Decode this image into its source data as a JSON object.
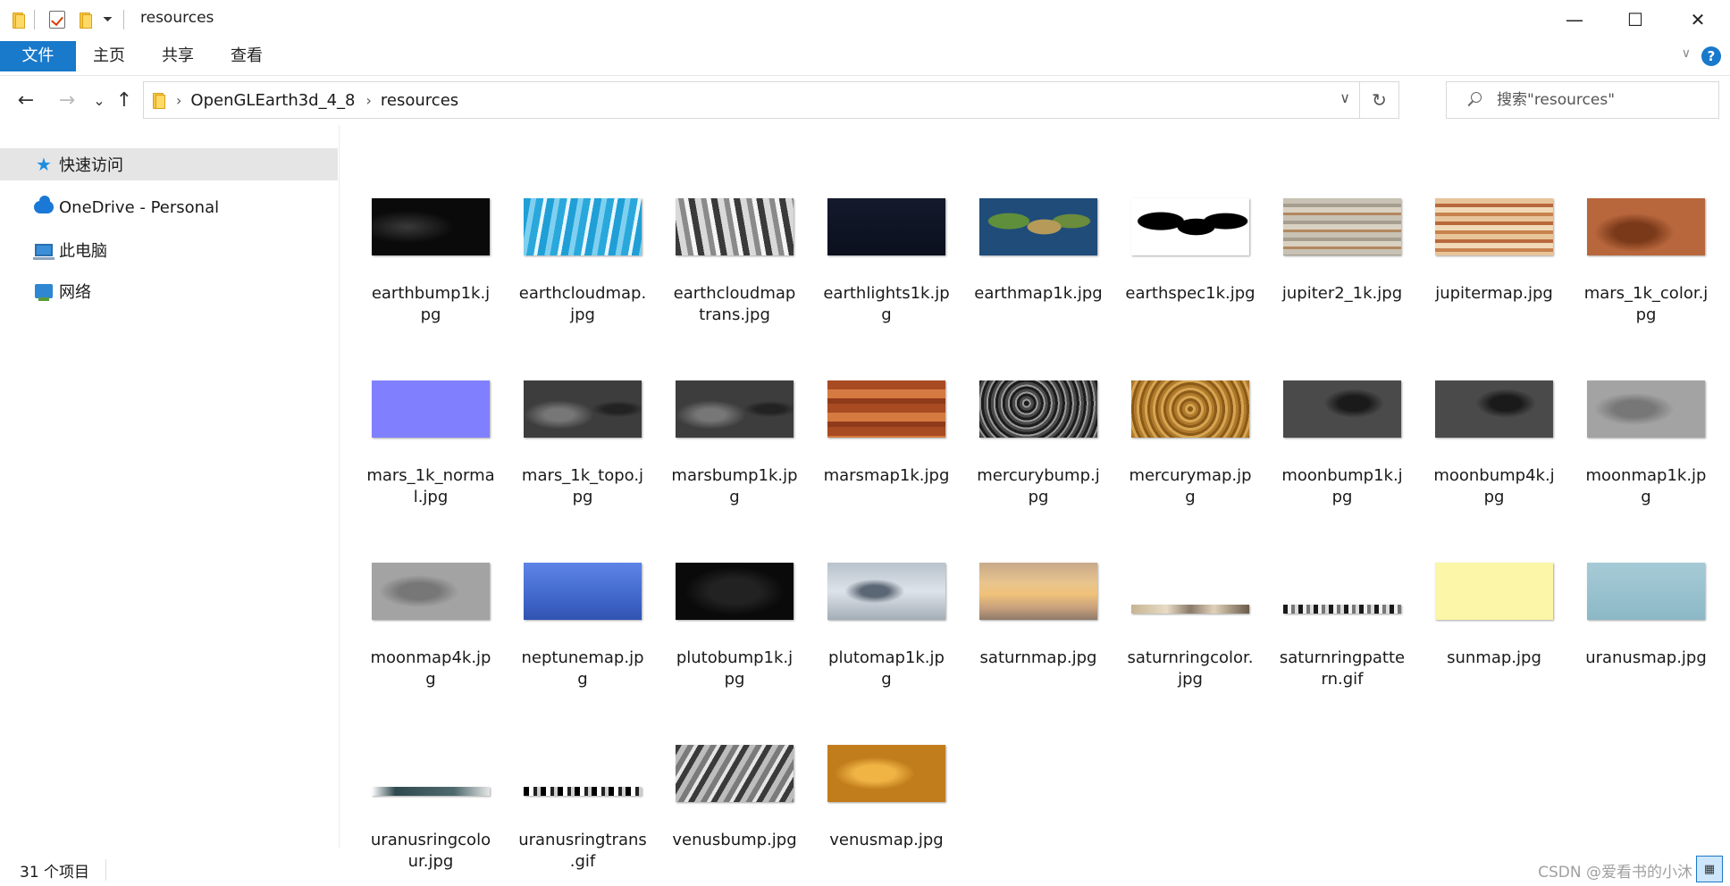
{
  "titlebar": {
    "title": "resources",
    "minimize": "—",
    "maximize": "☐",
    "close": "✕"
  },
  "ribbon": {
    "tabs": [
      "文件",
      "主页",
      "共享",
      "查看"
    ],
    "help": "?"
  },
  "nav": {
    "back": "←",
    "forward": "→",
    "recent": "⌄",
    "up": "↑",
    "breadcrumb": [
      "OpenGLEarth3d_4_8",
      "resources"
    ],
    "search_placeholder": "搜索\"resources\""
  },
  "sidebar": {
    "items": [
      {
        "label": "快速访问",
        "icon": "star-icon"
      },
      {
        "label": "OneDrive - Personal",
        "icon": "cloud-icon"
      },
      {
        "label": "此电脑",
        "icon": "computer-icon"
      },
      {
        "label": "网络",
        "icon": "network-icon"
      }
    ]
  },
  "files": [
    {
      "name": "earthbump1k.jpg",
      "lines": [
        "earthbump1k.j",
        "pg"
      ],
      "thumb": "bump-dark"
    },
    {
      "name": "earthcloudmap.jpg",
      "lines": [
        "earthcloudmap.",
        "jpg"
      ],
      "thumb": "clouds-blue"
    },
    {
      "name": "earthcloudmaptrans.jpg",
      "lines": [
        "earthcloudmap",
        "trans.jpg"
      ],
      "thumb": "clouds-gray"
    },
    {
      "name": "earthlights1k.jpg",
      "lines": [
        "earthlights1k.jp",
        "g"
      ],
      "thumb": "night"
    },
    {
      "name": "earthmap1k.jpg",
      "lines": [
        "earthmap1k.jpg"
      ],
      "thumb": "earth"
    },
    {
      "name": "earthspec1k.jpg",
      "lines": [
        "earthspec1k.jpg"
      ],
      "thumb": "spec"
    },
    {
      "name": "jupiter2_1k.jpg",
      "lines": [
        "jupiter2_1k.jpg"
      ],
      "thumb": "jupiter2"
    },
    {
      "name": "jupitermap.jpg",
      "lines": [
        "jupitermap.jpg"
      ],
      "thumb": "jupiter"
    },
    {
      "name": "mars_1k_color.jpg",
      "lines": [
        "mars_1k_color.j",
        "pg"
      ],
      "thumb": "mars-color"
    },
    {
      "name": "mars_1k_normal.jpg",
      "lines": [
        "mars_1k_norma",
        "l.jpg"
      ],
      "thumb": "normal"
    },
    {
      "name": "mars_1k_topo.jpg",
      "lines": [
        "mars_1k_topo.j",
        "pg"
      ],
      "thumb": "topo"
    },
    {
      "name": "marsbump1k.jpg",
      "lines": [
        "marsbump1k.jp",
        "g"
      ],
      "thumb": "topo"
    },
    {
      "name": "marsmap1k.jpg",
      "lines": [
        "marsmap1k.jpg"
      ],
      "thumb": "mars"
    },
    {
      "name": "mercurybump.jpg",
      "lines": [
        "mercurybump.j",
        "pg"
      ],
      "thumb": "mercury-bump"
    },
    {
      "name": "mercurymap.jpg",
      "lines": [
        "mercurymap.jp",
        "g"
      ],
      "thumb": "mercury"
    },
    {
      "name": "moonbump1k.jpg",
      "lines": [
        "moonbump1k.j",
        "pg"
      ],
      "thumb": "moon-bump"
    },
    {
      "name": "moonbump4k.jpg",
      "lines": [
        "moonbump4k.j",
        "pg"
      ],
      "thumb": "moon-bump"
    },
    {
      "name": "moonmap1k.jpg",
      "lines": [
        "moonmap1k.jp",
        "g"
      ],
      "thumb": "moon"
    },
    {
      "name": "moonmap4k.jpg",
      "lines": [
        "moonmap4k.jp",
        "g"
      ],
      "thumb": "moon"
    },
    {
      "name": "neptunemap.jpg",
      "lines": [
        "neptunemap.jp",
        "g"
      ],
      "thumb": "neptune"
    },
    {
      "name": "plutobump1k.jpg",
      "lines": [
        "plutobump1k.j",
        "pg"
      ],
      "thumb": "pluto-bump"
    },
    {
      "name": "plutomap1k.jpg",
      "lines": [
        "plutomap1k.jp",
        "g"
      ],
      "thumb": "pluto"
    },
    {
      "name": "saturnmap.jpg",
      "lines": [
        "saturnmap.jpg"
      ],
      "thumb": "saturn"
    },
    {
      "name": "saturnringcolor.jpg",
      "lines": [
        "saturnringcolor.",
        "jpg"
      ],
      "thumb": "ring-color"
    },
    {
      "name": "saturnringpattern.gif",
      "lines": [
        "saturnringpatte",
        "rn.gif"
      ],
      "thumb": "ring-pattern"
    },
    {
      "name": "sunmap.jpg",
      "lines": [
        "sunmap.jpg"
      ],
      "thumb": "sun"
    },
    {
      "name": "uranusmap.jpg",
      "lines": [
        "uranusmap.jpg"
      ],
      "thumb": "uranus"
    },
    {
      "name": "uranusringcolour.jpg",
      "lines": [
        "uranusringcolo",
        "ur.jpg"
      ],
      "thumb": "uranus-ring"
    },
    {
      "name": "uranusringtrans.gif",
      "lines": [
        "uranusringtrans",
        ".gif"
      ],
      "thumb": "uranus-ring-trans"
    },
    {
      "name": "venusbump.jpg",
      "lines": [
        "venusbump.jpg"
      ],
      "thumb": "venus-bump"
    },
    {
      "name": "venusmap.jpg",
      "lines": [
        "venusmap.jpg"
      ],
      "thumb": "venus"
    }
  ],
  "status": {
    "count": "31 个项目",
    "watermark": "CSDN @爱看书的小沐"
  },
  "colors": {
    "accent": "#1979ca",
    "selection": "#e5e5e5"
  }
}
